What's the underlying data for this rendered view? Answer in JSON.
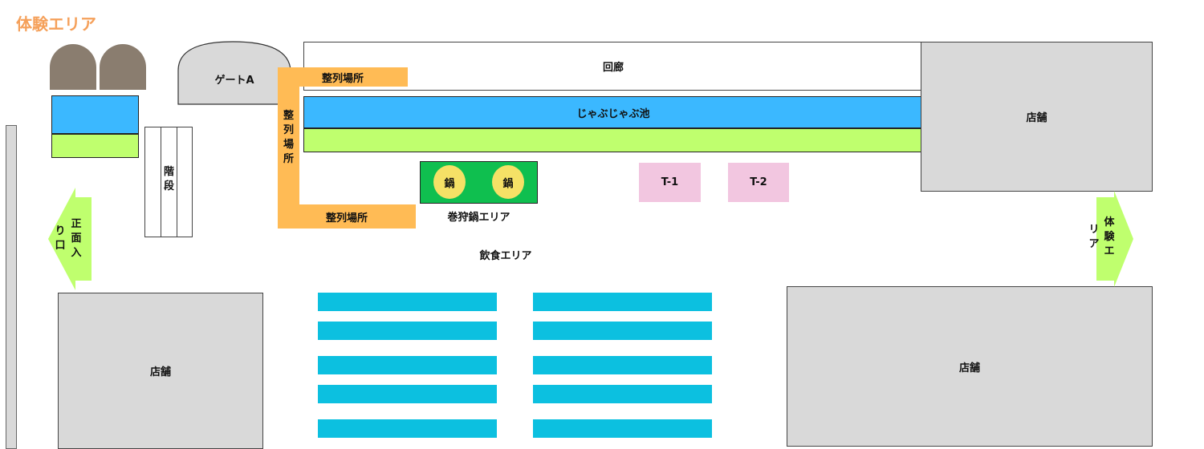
{
  "title": "体験エリア",
  "labels": {
    "gate": "ゲートA",
    "corridor": "回廊",
    "pool": "じゃぶじゃぶ池",
    "queue_top": "整列場所",
    "queue_vertical": [
      "整",
      "列",
      "場",
      "所"
    ],
    "queue_bottom": "整列場所",
    "stairs": [
      "階",
      "段"
    ],
    "pot": "鍋",
    "pot_area": "巻狩鍋エリア",
    "table1": "T-1",
    "table2": "T-2",
    "food_area": "飲食エリア",
    "shop": "店舗",
    "main_entrance_col1": [
      "正",
      "面",
      "入"
    ],
    "main_entrance_col2": [
      "り",
      "口"
    ],
    "exp_area_col1": [
      "体",
      "験",
      "エ"
    ],
    "exp_area_col2": [
      "リ",
      "ア"
    ]
  },
  "colors": {
    "title": "#f5a05a",
    "gray_shape": "#8a7d6f",
    "pool_blue": "#3bb8ff",
    "lime": "#bfff6e",
    "queue_orange": "#ffbb55",
    "pot_green": "#0fbf4f",
    "pot_yellow": "#f5e166",
    "table_pink": "#f2c6e0",
    "shop_gray": "#d9d9d9",
    "seat_cyan": "#0cc0e0",
    "arrow_green": "#bfff6e"
  }
}
